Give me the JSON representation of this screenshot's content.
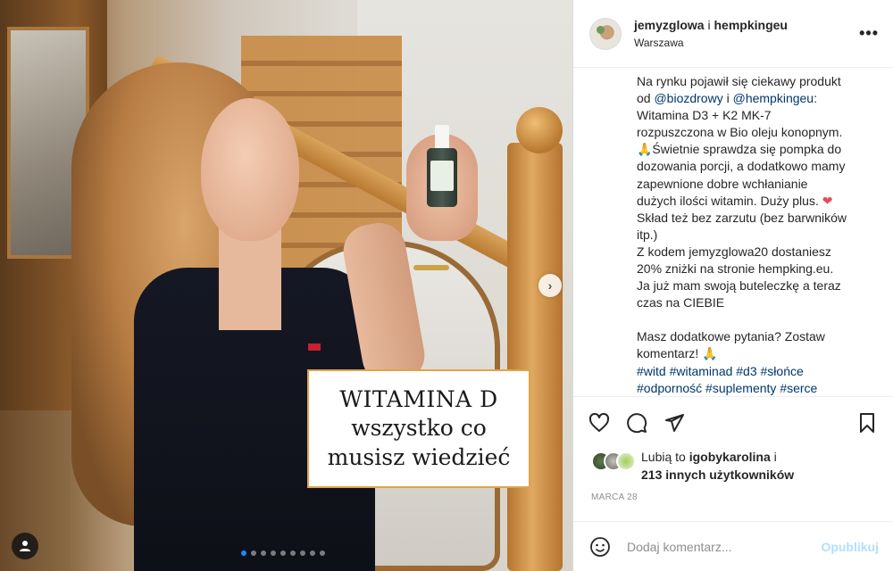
{
  "post": {
    "overlay_text": {
      "line1": "WITAMINA D",
      "line2": "wszystko co",
      "line3": "musisz wiedzieć"
    },
    "carousel": {
      "slides": 9,
      "active_index": 0
    }
  },
  "header": {
    "author": "jemyzglowa",
    "separator": "i",
    "coauthor": "hempkingeu",
    "location": "Warszawa",
    "more_icon": "ellipsis-icon"
  },
  "caption": {
    "lines": [
      [
        "Na rynku pojawił się ciekawy produkt"
      ],
      [
        "od ",
        "@biozdrowy",
        " i ",
        "@hempkingeu",
        ":"
      ],
      [
        "Witamina D3 + K2 MK-7"
      ],
      [
        "rozpuszczona w Bio oleju konopnym."
      ],
      [
        "🙏Świetnie sprawdza się pompka do"
      ],
      [
        "dozowania porcji, a dodatkowo mamy"
      ],
      [
        "zapewnione dobre wchłanianie"
      ],
      [
        "dużych ilości witamin. Duży plus. ",
        "❤"
      ],
      [
        "Skład też bez zarzutu (bez barwników"
      ],
      [
        "itp.)"
      ],
      [
        "Z kodem jemyzglowa20 dostaniesz"
      ],
      [
        "20% zniżki na stronie hempking.eu."
      ],
      [
        "Ja już mam swoją buteleczkę a teraz"
      ],
      [
        "czas na CIEBIE"
      ],
      [
        ""
      ],
      [
        "Masz dodatkowe pytania? Zostaw"
      ],
      [
        "komentarz! 🙏"
      ],
      [
        "#witd #witaminad #d3 #słońce"
      ],
      [
        "#odporność #suplementy #serce"
      ]
    ]
  },
  "actions": {
    "like_icon": "heart-icon",
    "comment_icon": "comment-icon",
    "share_icon": "send-icon",
    "save_icon": "bookmark-icon"
  },
  "likes": {
    "prefix": "Lubią to ",
    "user": "igobykarolina",
    "joiner": " i",
    "others": "213 innych użytkowników"
  },
  "date": "MARCA 28",
  "comment": {
    "placeholder": "Dodaj komentarz...",
    "post_label": "Opublikuj",
    "emoji_icon": "smiley-icon"
  },
  "colors": {
    "link": "#00376b",
    "muted": "#8e8e8e",
    "post_disabled": "#b2dffc",
    "heart": "#ed4956",
    "carousel_active": "#1b8bf6",
    "overlay_border": "#e0a44a"
  }
}
